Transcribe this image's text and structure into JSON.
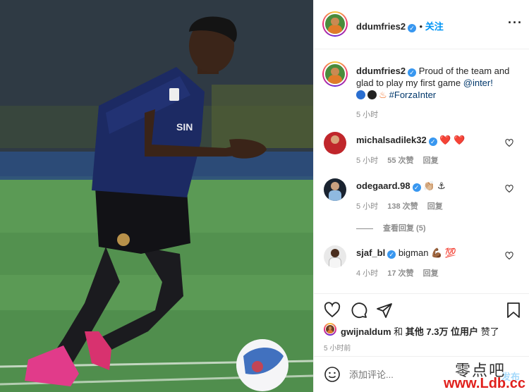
{
  "post": {
    "author": "ddumfries2",
    "follow_label": "关注",
    "more_icon": "more-horizontal-icon",
    "caption_text": "Proud of the team and glad to play my first game",
    "caption_mention": "@inter!",
    "caption_hashtag": "#ForzaInter",
    "caption_time": "5 小时"
  },
  "comments": [
    {
      "user": "michalsadilek32",
      "text": "❤️ ❤️",
      "time": "5 小时",
      "likes": "55 次赞",
      "reply": "回复"
    },
    {
      "user": "odegaard.98",
      "text": "👏🏼 ⚓",
      "time": "5 小时",
      "likes": "138 次赞",
      "reply": "回复",
      "view_replies": "查看回复 (5)"
    },
    {
      "user": "sjaf_bl",
      "text": "bigman 💪🏾 💯",
      "time": "4 小时",
      "likes": "17 次赞",
      "reply": "回复"
    }
  ],
  "likes": {
    "user": "gwijnaldum",
    "and": "和",
    "others": "其他 7.3万 位用户",
    "suffix": "赞了",
    "time": "5 小时前"
  },
  "comment_input": {
    "placeholder": "添加评论...",
    "post_label": "发布"
  },
  "watermark": {
    "line1": "零点吧",
    "line2": "www.Ldb.cc"
  },
  "colors": {
    "accent": "#0095f6",
    "verified": "#3897f0",
    "heart_red": "#ed4956"
  }
}
